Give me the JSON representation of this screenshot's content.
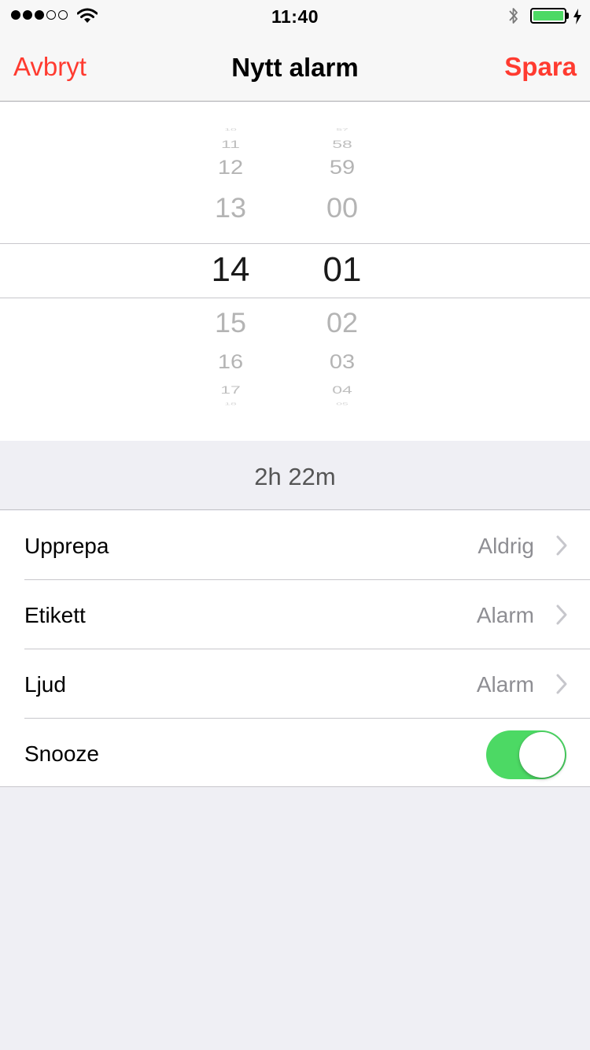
{
  "status_bar": {
    "time": "11:40",
    "signal_strength": 3,
    "signal_max": 5,
    "battery_level": 1.0,
    "battery_color": "#4cd964",
    "charging": true,
    "icons": [
      "signal-dots-icon",
      "wifi-icon",
      "bluetooth-icon",
      "battery-icon",
      "charging-bolt-icon"
    ]
  },
  "nav": {
    "cancel_label": "Avbryt",
    "title": "Nytt alarm",
    "save_label": "Spara",
    "accent_color": "#ff3b30"
  },
  "picker": {
    "hours": [
      "10",
      "11",
      "12",
      "13",
      "14",
      "15",
      "16",
      "17",
      "18"
    ],
    "minutes": [
      "57",
      "58",
      "59",
      "00",
      "01",
      "02",
      "03",
      "04",
      "05"
    ],
    "selected_hour": "14",
    "selected_minute": "01"
  },
  "countdown": "2h 22m",
  "settings": {
    "repeat": {
      "label": "Upprepa",
      "value": "Aldrig"
    },
    "label": {
      "label": "Etikett",
      "value": "Alarm"
    },
    "sound": {
      "label": "Ljud",
      "value": "Alarm"
    },
    "snooze": {
      "label": "Snooze",
      "enabled": true,
      "color": "#4cd964"
    }
  }
}
